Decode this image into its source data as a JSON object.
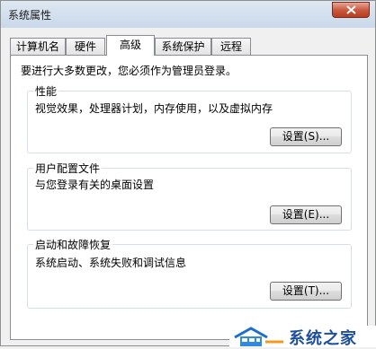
{
  "window": {
    "title": "系统属性"
  },
  "tabs": [
    {
      "label": "计算机名"
    },
    {
      "label": "硬件"
    },
    {
      "label": "高级",
      "active": true
    },
    {
      "label": "系统保护"
    },
    {
      "label": "远程"
    }
  ],
  "notice": "要进行大多数更改，您必须作为管理员登录。",
  "groups": {
    "performance": {
      "title": "性能",
      "description": "视觉效果，处理器计划，内存使用，以及虚拟内存",
      "button": "设置(S)..."
    },
    "user_profiles": {
      "title": "用户配置文件",
      "description": "与您登录有关的桌面设置",
      "button": "设置(E)..."
    },
    "startup_recovery": {
      "title": "启动和故障恢复",
      "description": "系统启动、系统失败和调试信息",
      "button": "设置(T)..."
    }
  },
  "watermark": {
    "text": "系统之家"
  },
  "colors": {
    "close_button": "#c7563b",
    "watermark_text": "#1d4f9c"
  }
}
